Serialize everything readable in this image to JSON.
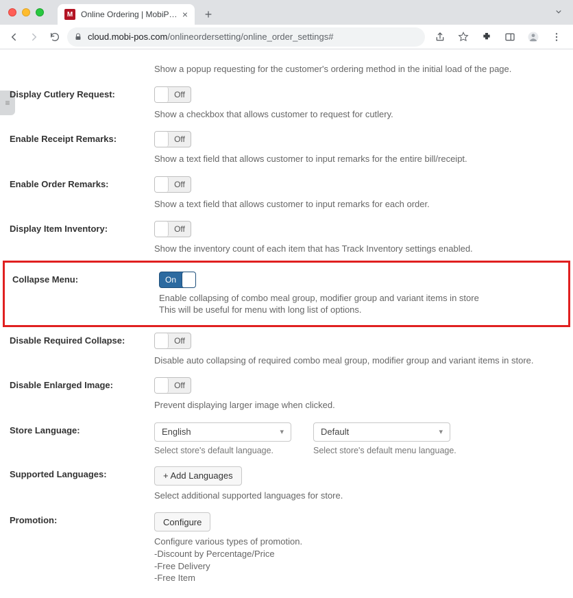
{
  "browser": {
    "tab_title": "Online Ordering | MobiPOS",
    "favicon_letter": "M",
    "url_host": "cloud.mobi-pos.com",
    "url_path": "/onlineordersetting/online_order_settings#"
  },
  "rows": {
    "intro_desc": "Show a popup requesting for the customer's ordering method in the initial load of the page.",
    "cutlery": {
      "label": "Display Cutlery Request:",
      "state": "Off",
      "desc": "Show a checkbox that allows customer to request for cutlery."
    },
    "receipt_remarks": {
      "label": "Enable Receipt Remarks:",
      "state": "Off",
      "desc": "Show a text field that allows customer to input remarks for the entire bill/receipt."
    },
    "order_remarks": {
      "label": "Enable Order Remarks:",
      "state": "Off",
      "desc": "Show a text field that allows customer to input remarks for each order."
    },
    "inventory": {
      "label": "Display Item Inventory:",
      "state": "Off",
      "desc": "Show the inventory count of each item that has Track Inventory settings enabled."
    },
    "collapse": {
      "label": "Collapse Menu:",
      "state": "On",
      "desc1": "Enable collapsing of combo meal group, modifier group and variant items in store",
      "desc2": "This will be useful for menu with long list of options."
    },
    "req_collapse": {
      "label": "Disable Required Collapse:",
      "state": "Off",
      "desc": "Disable auto collapsing of required combo meal group, modifier group and variant items in store."
    },
    "enlarged": {
      "label": "Disable Enlarged Image:",
      "state": "Off",
      "desc": "Prevent displaying larger image when clicked."
    },
    "store_lang": {
      "label": "Store Language:",
      "value1": "English",
      "help1": "Select store's default language.",
      "value2": "Default",
      "help2": "Select store's default menu language."
    },
    "supported": {
      "label": "Supported Languages:",
      "button": "+ Add Languages",
      "desc": "Select additional supported languages for store."
    },
    "promo": {
      "label": "Promotion:",
      "button": "Configure",
      "d1": "Configure various types of promotion.",
      "d2": "-Discount by Percentage/Price",
      "d3": "-Free Delivery",
      "d4": "-Free Item"
    }
  }
}
